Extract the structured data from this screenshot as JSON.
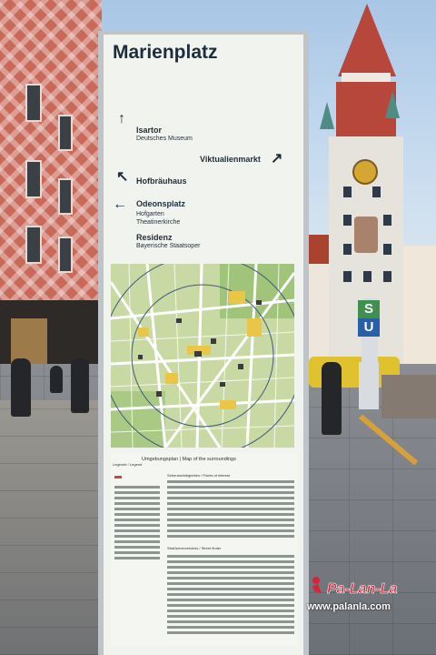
{
  "scene": {
    "description_labels": {
      "u_bahn_top": "S",
      "u_bahn_bottom": "U"
    }
  },
  "sign": {
    "title": "Marienplatz",
    "directions": [
      {
        "arrow": "↑",
        "main": "Isartor",
        "sub": "Deutsches Museum"
      },
      {
        "arrow": "↗",
        "main": "Viktualienmarkt",
        "sub": ""
      },
      {
        "arrow": "↖",
        "main": "Hofbräuhaus",
        "sub": ""
      },
      {
        "arrow": "←",
        "main": "Odeonsplatz",
        "sub": "Hofgarten\nTheatinerkirche"
      },
      {
        "arrow": "",
        "main": "Residenz",
        "sub": "Bayerische Staatsoper"
      }
    ],
    "map_header": "Umgebungsplan | Map of the surroundings",
    "map_subheader": "Sehenswürdigkeiten / Points of interest",
    "map_streets_header": "Straßenverzeichnis / Street finder",
    "legend_title": "Legende / Legend"
  },
  "watermark": {
    "logo": "Pa-Lan-La",
    "url": "www.palanla.com"
  },
  "colors": {
    "sign_text": "#1e2d3d",
    "map_green": "#c9d9a4",
    "map_yellow": "#e9c647",
    "u_bahn_blue": "#2b5ea8",
    "s_bahn_green": "#3f8f4e",
    "watermark_red": "#d8243a"
  }
}
